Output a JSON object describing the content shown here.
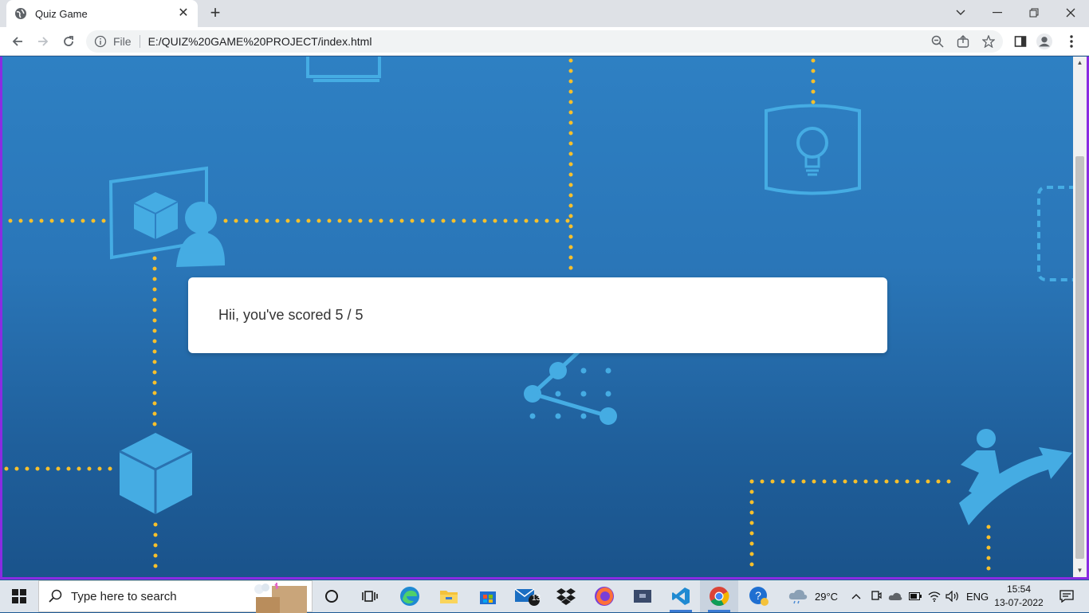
{
  "browser": {
    "tab_title": "Quiz Game",
    "tab_close": "✕",
    "new_tab": "+",
    "address_prefix": "File",
    "url": "E:/QUIZ%20GAME%20PROJECT/index.html"
  },
  "page": {
    "score_message": "Hii, you've scored 5 / 5",
    "colors": {
      "accent": "#8a2be2",
      "dots": "#f7c02b",
      "icons": "#45ace3",
      "bg_top": "#2e80c3",
      "bg_bottom": "#1a538b"
    }
  },
  "taskbar": {
    "search_placeholder": "Type here to search",
    "mail_badge": "13",
    "weather": "29°C",
    "language": "ENG",
    "time": "15:54",
    "date": "13-07-2022"
  }
}
